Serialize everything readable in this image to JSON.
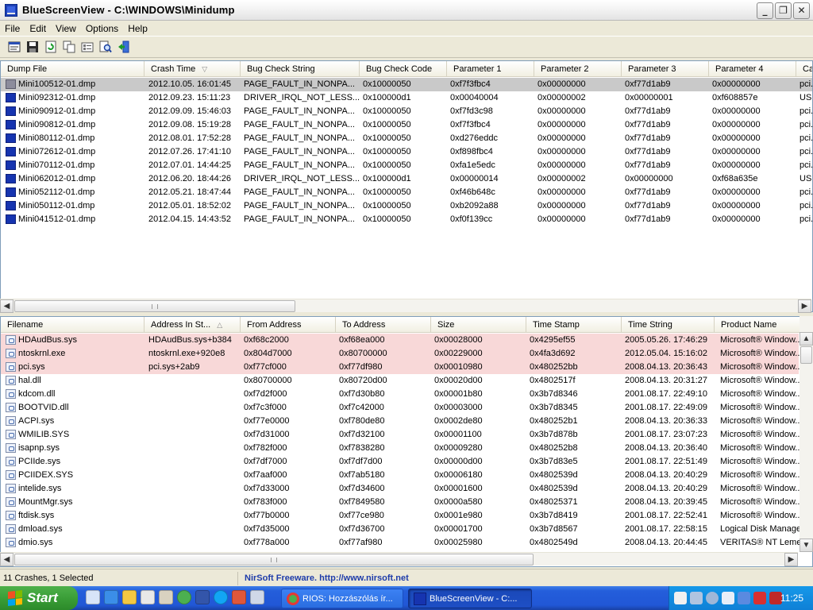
{
  "window": {
    "title": "BlueScreenView  -  C:\\WINDOWS\\Minidump",
    "controls": [
      "_",
      "❐",
      "✕"
    ]
  },
  "menu": [
    "File",
    "Edit",
    "View",
    "Options",
    "Help"
  ],
  "toolbar": [
    "properties-icon",
    "save-icon",
    "refresh-icon",
    "copy-icon",
    "options-icon",
    "find-icon",
    "exit-icon"
  ],
  "dumps": {
    "columns": [
      "Dump File",
      "Crash Time",
      "Bug Check String",
      "Bug Check Code",
      "Parameter 1",
      "Parameter 2",
      "Parameter 3",
      "Parameter 4",
      "Ca"
    ],
    "rows": [
      [
        "Mini100512-01.dmp",
        "2012.10.05. 16:01:45",
        "PAGE_FAULT_IN_NONPA...",
        "0x10000050",
        "0xf7f3fbc4",
        "0x00000000",
        "0xf77d1ab9",
        "0x00000000",
        "pci.."
      ],
      [
        "Mini092312-01.dmp",
        "2012.09.23. 15:11:23",
        "DRIVER_IRQL_NOT_LESS...",
        "0x100000d1",
        "0x00040004",
        "0x00000002",
        "0x00000001",
        "0xf608857e",
        "USE"
      ],
      [
        "Mini090912-01.dmp",
        "2012.09.09. 15:46:03",
        "PAGE_FAULT_IN_NONPA...",
        "0x10000050",
        "0xf7fd3c98",
        "0x00000000",
        "0xf77d1ab9",
        "0x00000000",
        "pci.."
      ],
      [
        "Mini090812-01.dmp",
        "2012.09.08. 15:19:28",
        "PAGE_FAULT_IN_NONPA...",
        "0x10000050",
        "0xf7f3fbc4",
        "0x00000000",
        "0xf77d1ab9",
        "0x00000000",
        "pci.."
      ],
      [
        "Mini080112-01.dmp",
        "2012.08.01. 17:52:28",
        "PAGE_FAULT_IN_NONPA...",
        "0x10000050",
        "0xd276eddc",
        "0x00000000",
        "0xf77d1ab9",
        "0x00000000",
        "pci.."
      ],
      [
        "Mini072612-01.dmp",
        "2012.07.26. 17:41:10",
        "PAGE_FAULT_IN_NONPA...",
        "0x10000050",
        "0xf898fbc4",
        "0x00000000",
        "0xf77d1ab9",
        "0x00000000",
        "pci.."
      ],
      [
        "Mini070112-01.dmp",
        "2012.07.01. 14:44:25",
        "PAGE_FAULT_IN_NONPA...",
        "0x10000050",
        "0xfa1e5edc",
        "0x00000000",
        "0xf77d1ab9",
        "0x00000000",
        "pci.."
      ],
      [
        "Mini062012-01.dmp",
        "2012.06.20. 18:44:26",
        "DRIVER_IRQL_NOT_LESS...",
        "0x100000d1",
        "0x00000014",
        "0x00000002",
        "0x00000000",
        "0xf68a635e",
        "USE"
      ],
      [
        "Mini052112-01.dmp",
        "2012.05.21. 18:47:44",
        "PAGE_FAULT_IN_NONPA...",
        "0x10000050",
        "0xf46b648c",
        "0x00000000",
        "0xf77d1ab9",
        "0x00000000",
        "pci.."
      ],
      [
        "Mini050112-01.dmp",
        "2012.05.01. 18:52:02",
        "PAGE_FAULT_IN_NONPA...",
        "0x10000050",
        "0xb2092a88",
        "0x00000000",
        "0xf77d1ab9",
        "0x00000000",
        "pci.."
      ],
      [
        "Mini041512-01.dmp",
        "2012.04.15. 14:43:52",
        "PAGE_FAULT_IN_NONPA...",
        "0x10000050",
        "0xf0f139cc",
        "0x00000000",
        "0xf77d1ab9",
        "0x00000000",
        "pci.."
      ]
    ],
    "selected_row": 0
  },
  "drivers": {
    "columns": [
      "Filename",
      "Address In St...",
      "From Address",
      "To Address",
      "Size",
      "Time Stamp",
      "Time String",
      "Product Name"
    ],
    "rows": [
      [
        "HDAudBus.sys",
        "HDAudBus.sys+b384",
        "0xf68c2000",
        "0xf68ea000",
        "0x00028000",
        "0x4295ef55",
        "2005.05.26. 17:46:29",
        "Microsoft® Window..."
      ],
      [
        "ntoskrnl.exe",
        "ntoskrnl.exe+920e8",
        "0x804d7000",
        "0x80700000",
        "0x00229000",
        "0x4fa3d692",
        "2012.05.04. 15:16:02",
        "Microsoft® Window..."
      ],
      [
        "pci.sys",
        "pci.sys+2ab9",
        "0xf77cf000",
        "0xf77df980",
        "0x00010980",
        "0x480252bb",
        "2008.04.13. 20:36:43",
        "Microsoft® Window..."
      ],
      [
        "hal.dll",
        "",
        "0x80700000",
        "0x80720d00",
        "0x00020d00",
        "0x4802517f",
        "2008.04.13. 20:31:27",
        "Microsoft® Window..."
      ],
      [
        "kdcom.dll",
        "",
        "0xf7d2f000",
        "0xf7d30b80",
        "0x00001b80",
        "0x3b7d8346",
        "2001.08.17. 22:49:10",
        "Microsoft® Window..."
      ],
      [
        "BOOTVID.dll",
        "",
        "0xf7c3f000",
        "0xf7c42000",
        "0x00003000",
        "0x3b7d8345",
        "2001.08.17. 22:49:09",
        "Microsoft® Window..."
      ],
      [
        "ACPI.sys",
        "",
        "0xf77e0000",
        "0xf780de80",
        "0x0002de80",
        "0x480252b1",
        "2008.04.13. 20:36:33",
        "Microsoft® Window..."
      ],
      [
        "WMILIB.SYS",
        "",
        "0xf7d31000",
        "0xf7d32100",
        "0x00001100",
        "0x3b7d878b",
        "2001.08.17. 23:07:23",
        "Microsoft® Window..."
      ],
      [
        "isapnp.sys",
        "",
        "0xf782f000",
        "0xf7838280",
        "0x00009280",
        "0x480252b8",
        "2008.04.13. 20:36:40",
        "Microsoft® Window..."
      ],
      [
        "PCIIde.sys",
        "",
        "0xf7df7000",
        "0xf7df7d00",
        "0x00000d00",
        "0x3b7d83e5",
        "2001.08.17. 22:51:49",
        "Microsoft® Window..."
      ],
      [
        "PCIIDEX.SYS",
        "",
        "0xf7aaf000",
        "0xf7ab5180",
        "0x00006180",
        "0x4802539d",
        "2008.04.13. 20:40:29",
        "Microsoft® Window..."
      ],
      [
        "intelide.sys",
        "",
        "0xf7d33000",
        "0xf7d34600",
        "0x00001600",
        "0x4802539d",
        "2008.04.13. 20:40:29",
        "Microsoft® Window..."
      ],
      [
        "MountMgr.sys",
        "",
        "0xf783f000",
        "0xf7849580",
        "0x0000a580",
        "0x48025371",
        "2008.04.13. 20:39:45",
        "Microsoft® Window..."
      ],
      [
        "ftdisk.sys",
        "",
        "0xf77b0000",
        "0xf77ce980",
        "0x0001e980",
        "0x3b7d8419",
        "2001.08.17. 22:52:41",
        "Microsoft® Window..."
      ],
      [
        "dmload.sys",
        "",
        "0xf7d35000",
        "0xf7d36700",
        "0x00001700",
        "0x3b7d8567",
        "2001.08.17. 22:58:15",
        "Logical Disk Manage..."
      ],
      [
        "dmio.sys",
        "",
        "0xf778a000",
        "0xf77af980",
        "0x00025980",
        "0x4802549d",
        "2008.04.13. 20:44:45",
        "VERITAS® NT Leme..."
      ]
    ],
    "highlighted_rows": [
      0,
      1,
      2
    ]
  },
  "status": {
    "summary": "11 Crashes, 1 Selected",
    "link": "NirSoft Freeware.  http://www.nirsoft.net"
  },
  "taskbar": {
    "start_label": "Start",
    "tasks": [
      "RIOS: Hozzászólás ír...",
      "BlueScreenView  -  C:..."
    ],
    "clock": "11:25"
  },
  "colors": {
    "selected_row": "#c9c9c9",
    "highlight_row": "#f8d8d8",
    "link": "#1e3caa",
    "taskbar": "#245edb",
    "start": "#379a34"
  }
}
